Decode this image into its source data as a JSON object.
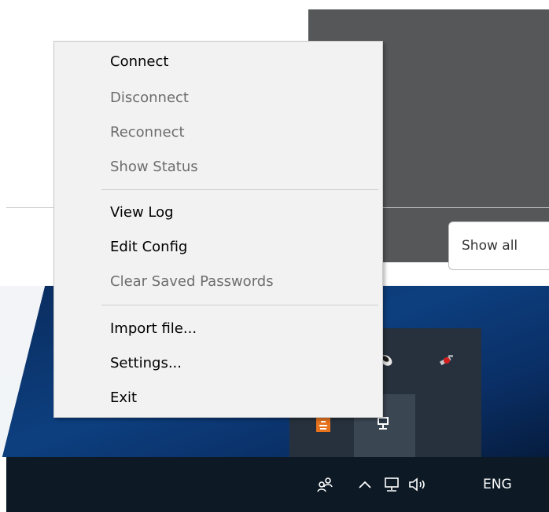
{
  "background": {
    "show_all_label": "Show all"
  },
  "context_menu": {
    "items": [
      {
        "label": "Connect",
        "enabled": true
      },
      {
        "label": "Disconnect",
        "enabled": false
      },
      {
        "label": "Reconnect",
        "enabled": false
      },
      {
        "label": "Show Status",
        "enabled": false
      },
      {
        "label": "View Log",
        "enabled": true
      },
      {
        "label": "Edit Config",
        "enabled": true
      },
      {
        "label": "Clear Saved Passwords",
        "enabled": false
      },
      {
        "label": "Import file...",
        "enabled": true
      },
      {
        "label": "Settings...",
        "enabled": true
      },
      {
        "label": "Exit",
        "enabled": true
      }
    ]
  },
  "tray_overflow": {
    "icons": [
      "mouse-icon",
      "satellite-icon",
      "openvpn-icon",
      "network-monitor-icon"
    ]
  },
  "taskbar": {
    "people_icon": "people-icon",
    "chevron_icon": "chevron-up-icon",
    "network_icon": "network-icon",
    "volume_icon": "volume-icon",
    "language": "ENG"
  },
  "colors": {
    "menu_bg": "#f2f2f2",
    "disabled_text": "#6d6d6d",
    "taskbar_bg": "#0d1a25",
    "desktop_bg": "#0d3f7f"
  }
}
